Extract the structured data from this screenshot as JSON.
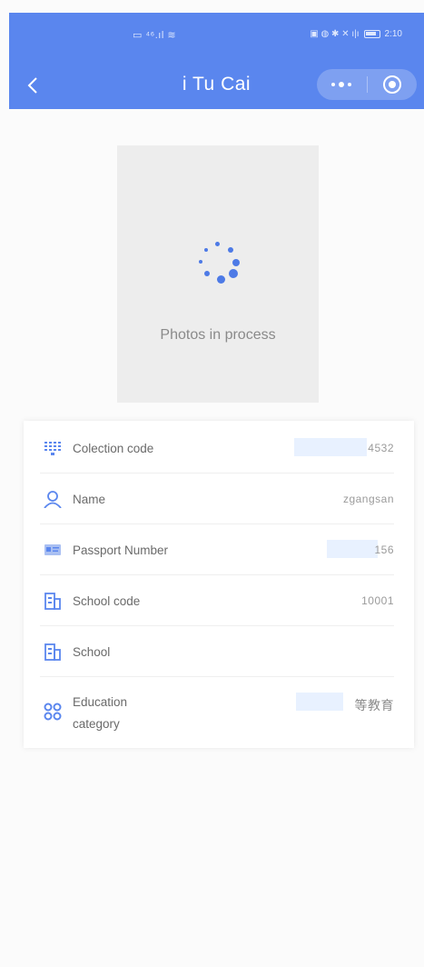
{
  "status_bar": {
    "left_icons": "▭ ⁴⁶.ıl ≋",
    "right_icons": "▣ ◍ ✱ ✕ ı|ı",
    "time": "2:10"
  },
  "nav": {
    "title": "i Tu Cai",
    "back_icon": "chevron-left-icon",
    "more_icon": "more-dots-icon",
    "close_icon": "target-icon"
  },
  "photo": {
    "caption": "Photos in process",
    "spinner_color": "#4d7ae6"
  },
  "info": {
    "rows": [
      {
        "label": "Colection code",
        "value": "4532",
        "icon": "grid-code-icon"
      },
      {
        "label": "Name",
        "value": "zgangsan",
        "icon": "user-icon"
      },
      {
        "label": "Passport Number",
        "value": "156",
        "icon": "id-card-icon"
      },
      {
        "label": "School code",
        "value": "10001",
        "icon": "building-icon"
      },
      {
        "label": "School",
        "value": "",
        "icon": "building-icon"
      },
      {
        "label": "Education category",
        "value": "等教育",
        "icon": "category-grid-icon"
      }
    ]
  },
  "colors": {
    "primary": "#5a86ee",
    "card_bg": "#ffffff",
    "photo_bg": "#ededed",
    "highlight": "#e8f1ff"
  }
}
